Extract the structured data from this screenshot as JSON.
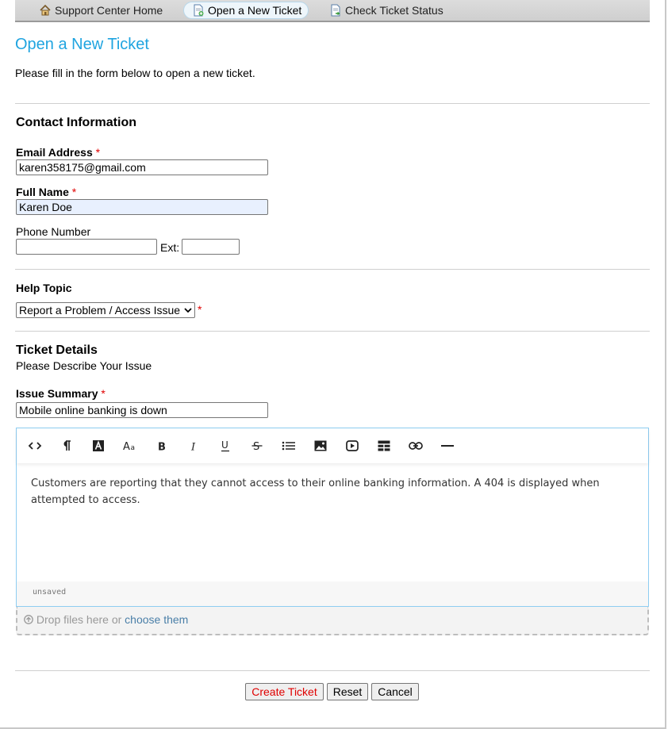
{
  "nav": {
    "items": [
      {
        "label": "Support Center Home",
        "icon": "home-icon"
      },
      {
        "label": "Open a New Ticket",
        "icon": "new-ticket-icon",
        "active": true
      },
      {
        "label": "Check Ticket Status",
        "icon": "ticket-status-icon"
      }
    ]
  },
  "page": {
    "title": "Open a New Ticket",
    "intro": "Please fill in the form below to open a new ticket."
  },
  "contact": {
    "heading": "Contact Information",
    "email_label": "Email Address",
    "email_value": "karen358175@gmail.com",
    "name_label": "Full Name",
    "name_value": "Karen Doe",
    "phone_label": "Phone Number",
    "phone_value": "",
    "ext_label": "Ext:",
    "ext_value": "",
    "required_mark": "*"
  },
  "help": {
    "heading": "Help Topic",
    "selected": "Report a Problem / Access Issue",
    "required_mark": "*"
  },
  "details": {
    "heading": "Ticket Details",
    "subheading": "Please Describe Your Issue",
    "summary_label": "Issue Summary",
    "summary_value": "Mobile online banking is down",
    "required_mark": "*"
  },
  "editor": {
    "toolbar": [
      "code-view",
      "paragraph-format",
      "font-color",
      "font-size",
      "bold",
      "italic",
      "underline",
      "strikethrough",
      "unordered-list",
      "insert-image",
      "insert-video",
      "insert-table",
      "insert-link",
      "horizontal-rule"
    ],
    "body": "Customers are reporting that they cannot access to their online banking information. A 404 is displayed when attempted to access.",
    "status": "unsaved"
  },
  "dropzone": {
    "text": "Drop files here or",
    "link": "choose them"
  },
  "buttons": {
    "create": "Create Ticket",
    "reset": "Reset",
    "cancel": "Cancel"
  },
  "colors": {
    "title": "#1fa4e0",
    "required": "#e00000",
    "create_button_text": "#e00000",
    "autofill_bg": "#e8f0fe",
    "editor_border": "#8ecdf2"
  }
}
